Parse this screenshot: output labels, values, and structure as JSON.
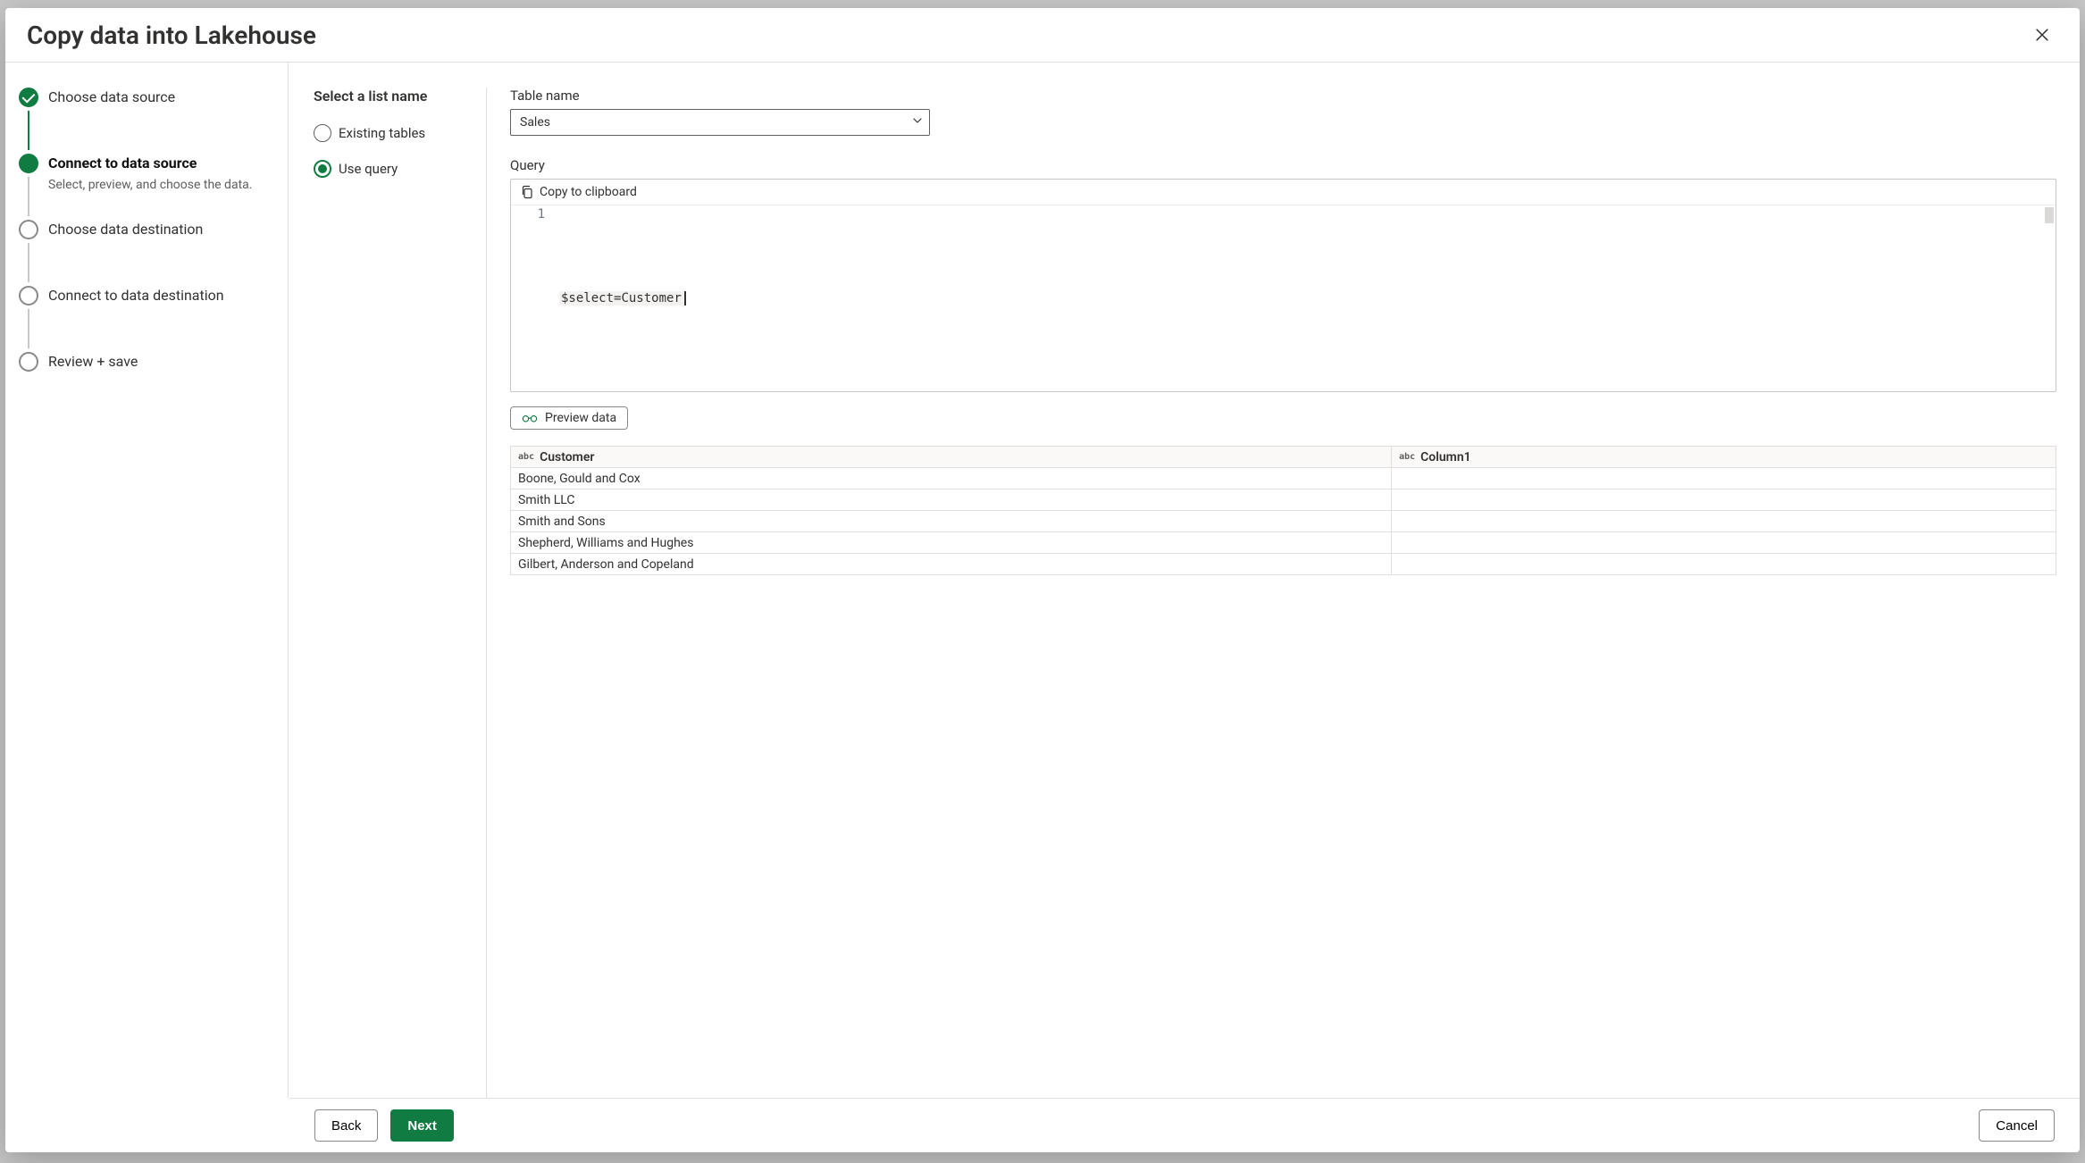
{
  "dialog": {
    "title": "Copy data into Lakehouse"
  },
  "steps": [
    {
      "title": "Choose data source",
      "state": "completed"
    },
    {
      "title": "Connect to data source",
      "subtitle": "Select, preview, and choose the data.",
      "state": "current"
    },
    {
      "title": "Choose data destination",
      "state": "upcoming"
    },
    {
      "title": "Connect to data destination",
      "state": "upcoming"
    },
    {
      "title": "Review + save",
      "state": "upcoming"
    }
  ],
  "leftPanel": {
    "heading": "Select a list name",
    "options": {
      "existing_label": "Existing tables",
      "use_query_label": "Use query",
      "selected": "use_query"
    }
  },
  "tableName": {
    "label": "Table name",
    "value": "Sales"
  },
  "query": {
    "label": "Query",
    "copy_label": "Copy to clipboard",
    "line_number": "1",
    "code_kw": "$select",
    "code_op": "=",
    "code_id": "Customer"
  },
  "preview": {
    "button_label": "Preview data",
    "columns": [
      {
        "type": "abc",
        "name": "Customer"
      },
      {
        "type": "abc",
        "name": "Column1"
      }
    ],
    "rows": [
      {
        "customer": "Boone, Gould and Cox",
        "col1": ""
      },
      {
        "customer": "Smith LLC",
        "col1": ""
      },
      {
        "customer": "Smith and Sons",
        "col1": ""
      },
      {
        "customer": "Shepherd, Williams and Hughes",
        "col1": ""
      },
      {
        "customer": "Gilbert, Anderson and Copeland",
        "col1": ""
      }
    ]
  },
  "footer": {
    "back": "Back",
    "next": "Next",
    "cancel": "Cancel"
  }
}
